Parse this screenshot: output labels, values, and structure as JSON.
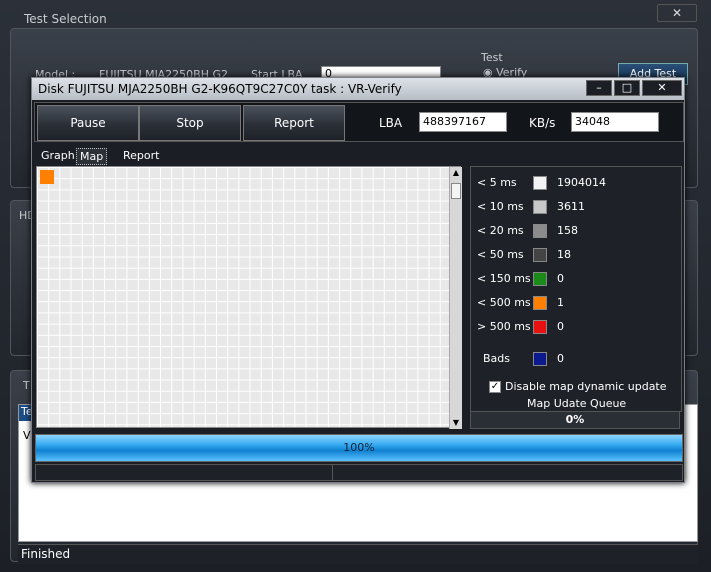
{
  "background_app": {
    "title": "Test Selection",
    "close_glyph": "✕",
    "model_label": "Model :",
    "model_value": "FUJITSU MJA2250BH G2",
    "start_lba_label": "Start LBA",
    "start_lba_value": "0",
    "test_group_label": "Test",
    "verify_option": "Verify",
    "add_test_label": "Add Test",
    "side_label_h": "HD",
    "side_label_t": "T",
    "list_header": "Te",
    "list_first": "V",
    "status_text": "Finished"
  },
  "dialog": {
    "title": "Disk FUJITSU MJA2250BH G2-K96QT9C27C0Y   task : VR-Verify",
    "controls": {
      "minimize": "–",
      "maximize": "□",
      "close": "✕"
    },
    "toolbar": {
      "pause_label": "Pause",
      "stop_label": "Stop",
      "report_label": "Report",
      "lba_label": "LBA",
      "lba_value": "488397167",
      "kbs_label": "KB/s",
      "kbs_value": "34048"
    },
    "tabs": [
      {
        "label": "Graph",
        "active": false
      },
      {
        "label": "Map",
        "active": true
      },
      {
        "label": "Report",
        "active": false
      }
    ],
    "legend": {
      "rows": [
        {
          "label": "< 5 ms",
          "color": "#f4f4f4",
          "count": "1904014"
        },
        {
          "label": "< 10 ms",
          "color": "#c8c8c8",
          "count": "3611"
        },
        {
          "label": "< 20 ms",
          "color": "#8c8c8c",
          "count": "158"
        },
        {
          "label": "< 50 ms",
          "color": "#444444",
          "count": "18"
        },
        {
          "label": "< 150 ms",
          "color": "#1a8a1a",
          "count": "0"
        },
        {
          "label": "< 500 ms",
          "color": "#ff7f00",
          "count": "1"
        },
        {
          "label": "> 500 ms",
          "color": "#e81010",
          "count": "0"
        },
        {
          "label": "Bads",
          "color": "#0b1a8c",
          "count": "0"
        }
      ],
      "disable_map_label": "Disable map dynamic update",
      "disable_map_checked": true,
      "queue_label": "Map Udate Queue",
      "queue_value": "0%"
    },
    "progress": {
      "value": 100,
      "text": "100%"
    }
  }
}
